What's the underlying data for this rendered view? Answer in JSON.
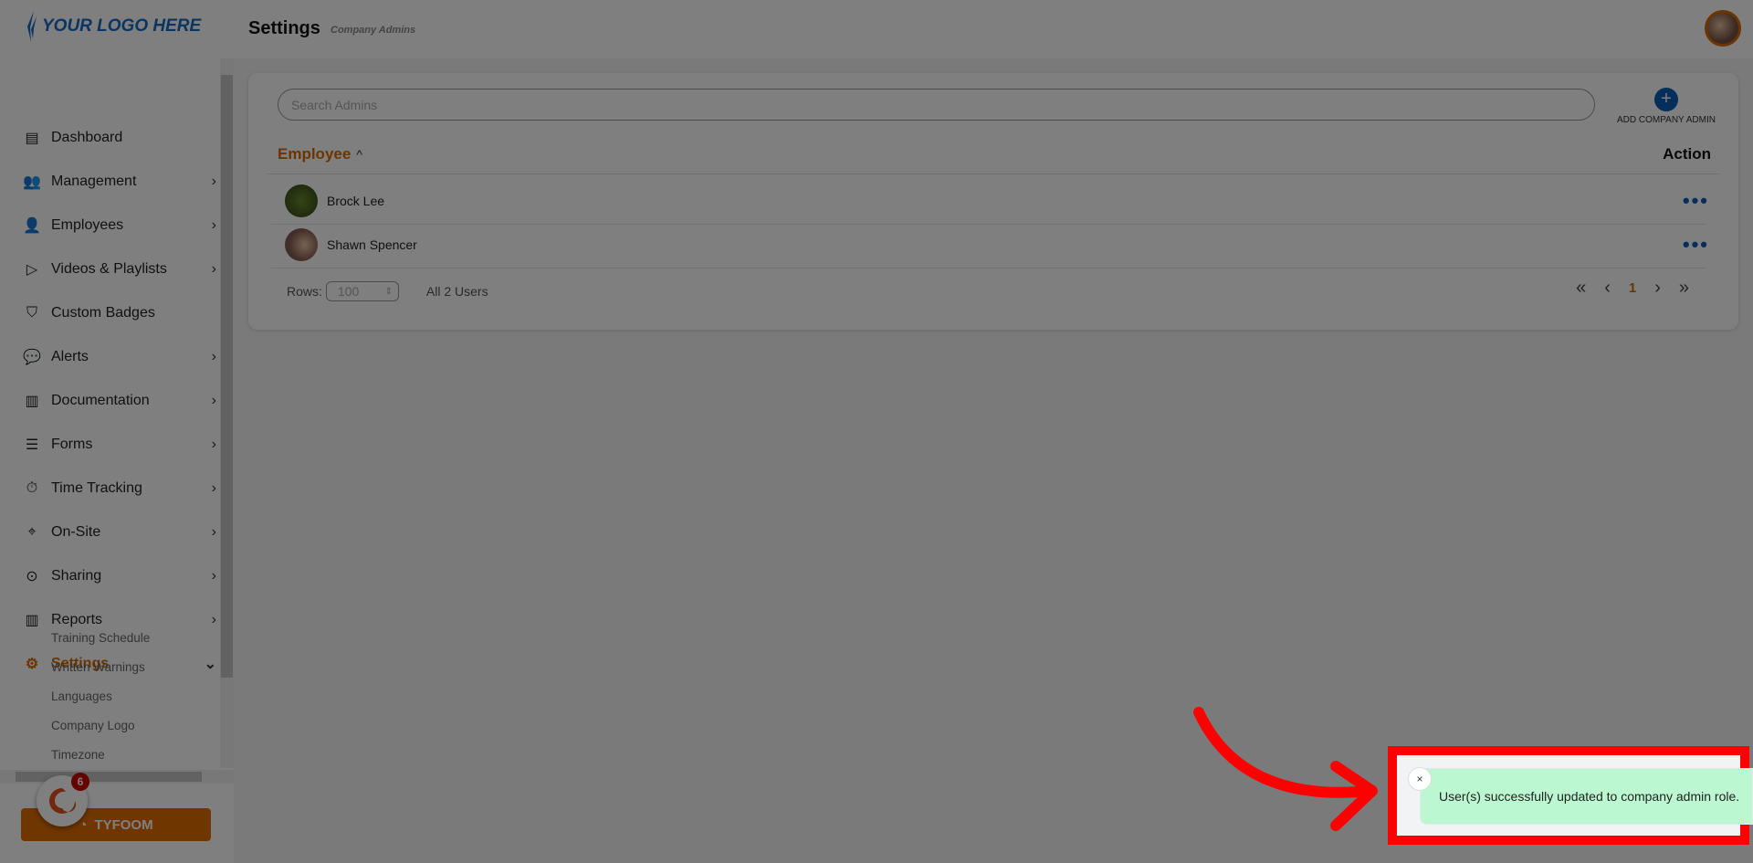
{
  "header": {
    "logo": "YOUR LOGO HERE",
    "title": "Settings",
    "subtitle": "Company Admins"
  },
  "sidebar": {
    "items": [
      {
        "label": "Dashboard",
        "icon": "dashboard-icon",
        "chevron": false
      },
      {
        "label": "Management",
        "icon": "users-icon",
        "chevron": true
      },
      {
        "label": "Employees",
        "icon": "user-icon",
        "chevron": true
      },
      {
        "label": "Videos & Playlists",
        "icon": "video-icon",
        "chevron": true
      },
      {
        "label": "Custom Badges",
        "icon": "badge-icon",
        "chevron": false
      },
      {
        "label": "Alerts",
        "icon": "chat-icon",
        "chevron": true
      },
      {
        "label": "Documentation",
        "icon": "document-icon",
        "chevron": true
      },
      {
        "label": "Forms",
        "icon": "form-icon",
        "chevron": true
      },
      {
        "label": "Time Tracking",
        "icon": "stopwatch-icon",
        "chevron": true
      },
      {
        "label": "On-Site",
        "icon": "location-icon",
        "chevron": true
      },
      {
        "label": "Sharing",
        "icon": "share-icon",
        "chevron": true
      },
      {
        "label": "Reports",
        "icon": "bar-chart-icon",
        "chevron": true
      },
      {
        "label": "Settings",
        "icon": "gear-icon",
        "chevron": true,
        "active": true
      }
    ],
    "sub_items": [
      "Training Schedule",
      "Written Warnings",
      "Languages",
      "Company Logo",
      "Timezone"
    ],
    "tyfoom_button": "TYFOOM",
    "notification_count": "6"
  },
  "main": {
    "search_placeholder": "Search Admins",
    "add_button": "ADD COMPANY ADMIN",
    "columns": {
      "employee": "Employee",
      "action": "Action"
    },
    "rows": [
      {
        "name": "Brock Lee"
      },
      {
        "name": "Shawn Spencer"
      }
    ],
    "rows_label": "Rows:",
    "rows_value": "100",
    "count": "All 2 Users",
    "page": "1"
  },
  "toast": {
    "message": "User(s) successfully updated to company admin role.",
    "close": "×"
  },
  "colors": {
    "accent": "#d96a00",
    "primary": "#0a5cb5",
    "toast_bg": "#bbf7d0",
    "annotation": "#ff0000"
  }
}
